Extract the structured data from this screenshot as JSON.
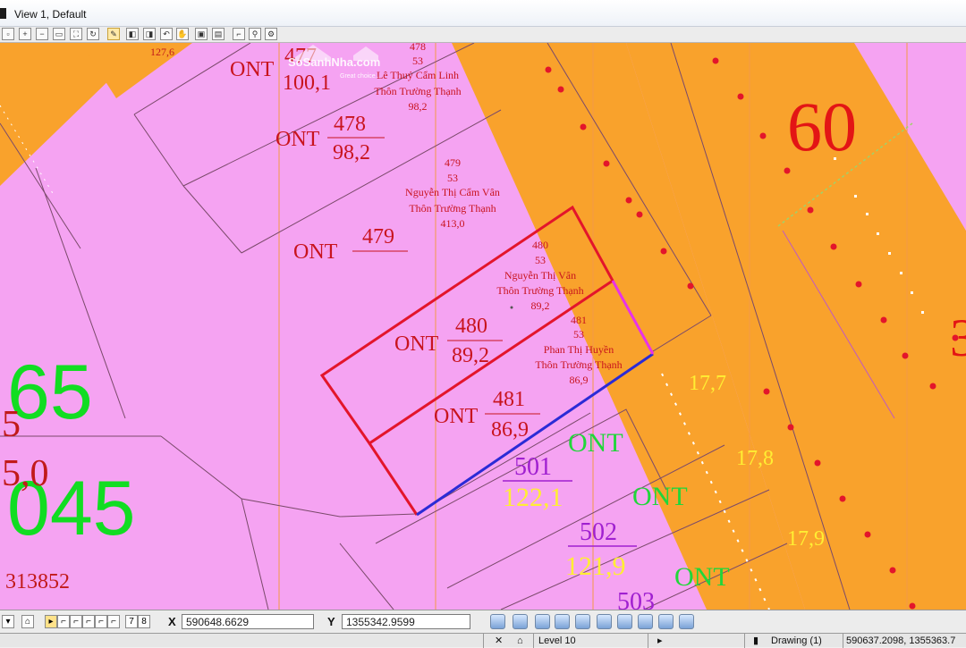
{
  "window": {
    "title": "View 1, Default"
  },
  "map": {
    "colors": {
      "residential": "#f5a3f2",
      "road": "#f9a22c",
      "parcel_line": "#7a4a6a",
      "highlight": "#e3152b",
      "boundary_blue": "#2b2bd6",
      "boundary_magenta": "#e832e8",
      "grid_line": "#f29a48"
    },
    "watermark": "SoSanhNha.com",
    "watermark_sub": "Great choice...",
    "road_number": "60",
    "left_numbers": [
      "65",
      "045",
      "5",
      "5,0",
      "313852"
    ],
    "parcels": [
      {
        "type": "ONT",
        "number": "477",
        "area": "100,1"
      },
      {
        "type": "ONT",
        "number": "478",
        "area": "98,2"
      },
      {
        "type": "ONT",
        "number": "479",
        "area": ""
      },
      {
        "type": "ONT",
        "number": "480",
        "area": "89,2"
      },
      {
        "type": "ONT",
        "number": "481",
        "area": "86,9"
      }
    ],
    "green_parcels": [
      {
        "type": "ONT",
        "number": "501",
        "area": "122,1"
      },
      {
        "type": "ONT",
        "number": "502",
        "area": "121,9"
      },
      {
        "type": "ONT",
        "number": "503",
        "area": ""
      }
    ],
    "owner_labels": [
      {
        "parcel": "478",
        "sheet": "53",
        "owner": "Lê Thuỷ Cẩm Linh",
        "village": "Thôn Trường Thạnh",
        "area": "98,2"
      },
      {
        "parcel": "479",
        "sheet": "53",
        "owner": "Nguyễn Thị Cẩm Vân",
        "village": "Thôn Trường Thạnh",
        "area": "413,0"
      },
      {
        "parcel": "480",
        "sheet": "53",
        "owner": "Nguyễn Thị Vân",
        "village": "Thôn Trường Thạnh",
        "area": "89,2"
      },
      {
        "parcel": "481",
        "sheet": "53",
        "owner": "Phan Thị Huyền",
        "village": "Thôn Trường Thạnh",
        "area": "86,9"
      }
    ],
    "edge_labels": [
      "127,6",
      "17,7",
      "17,8",
      "17,9"
    ]
  },
  "coords": {
    "x_label": "X",
    "x_value": "590648.6629",
    "y_label": "Y",
    "y_value": "1355342.9599"
  },
  "status": {
    "level": "Level 10",
    "drawing": "Drawing (1)",
    "cursor": "590637.2098, 1355363.7",
    "view_buttons": [
      "7",
      "8"
    ]
  }
}
